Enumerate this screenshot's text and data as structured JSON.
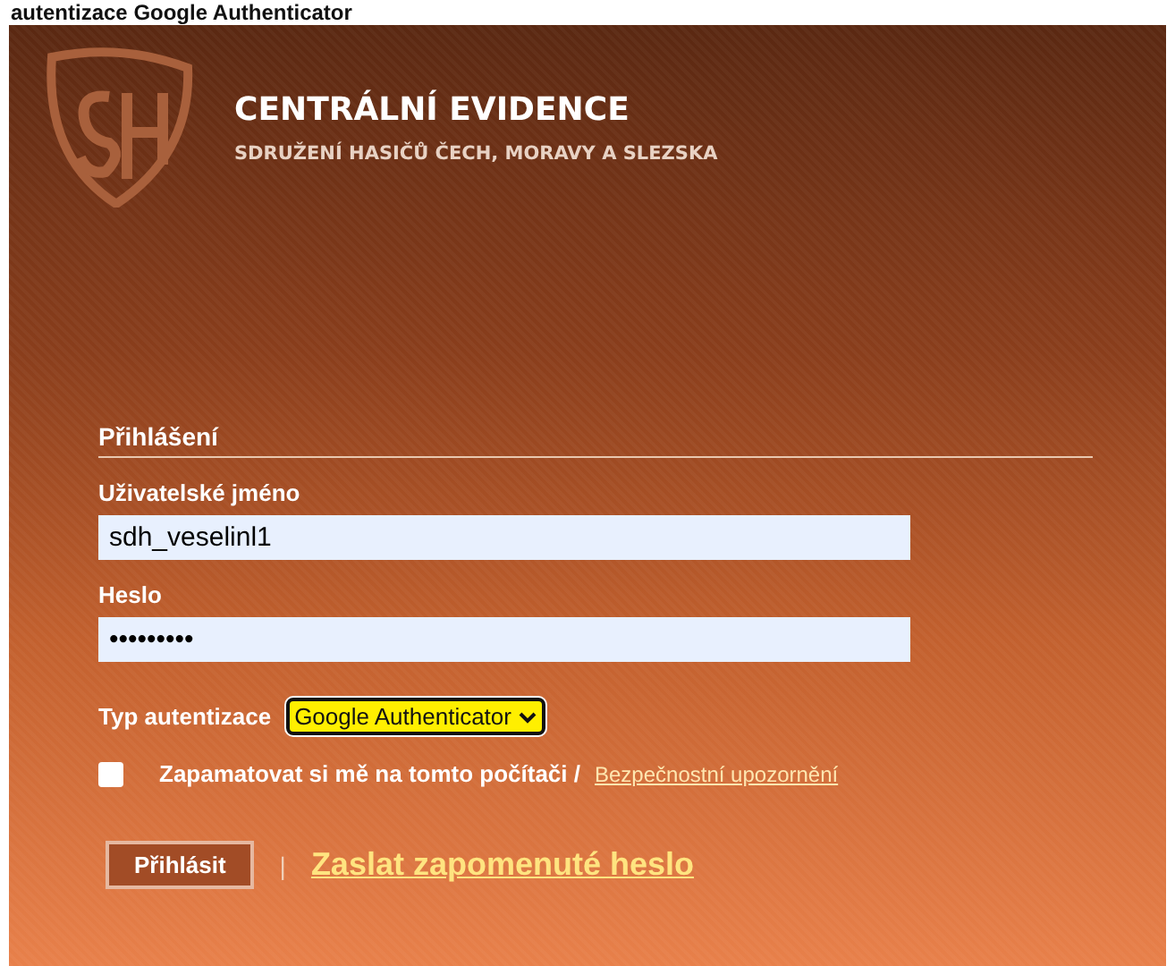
{
  "page_heading": "autentizace Google Authenticator",
  "header": {
    "title": "CENTRÁLNÍ EVIDENCE",
    "subtitle": "SDRUŽENÍ HASIČŮ ČECH, MORAVY A SLEZSKA"
  },
  "login": {
    "heading": "Přihlášení",
    "username": {
      "label": "Uživatelské jméno",
      "value": "sdh_veselinl1"
    },
    "password": {
      "label": "Heslo",
      "value": "•••••••••"
    },
    "auth_type": {
      "label": "Typ autentizace",
      "value": "Google Authenticator"
    },
    "remember": {
      "label": "Zapamatovat si mě na tomto počítači /",
      "checked": false,
      "link": "Bezpečnostní upozornění"
    },
    "submit": "Přihlásit",
    "separator": "|",
    "forgot_link": "Zaslat zapomenuté heslo"
  }
}
